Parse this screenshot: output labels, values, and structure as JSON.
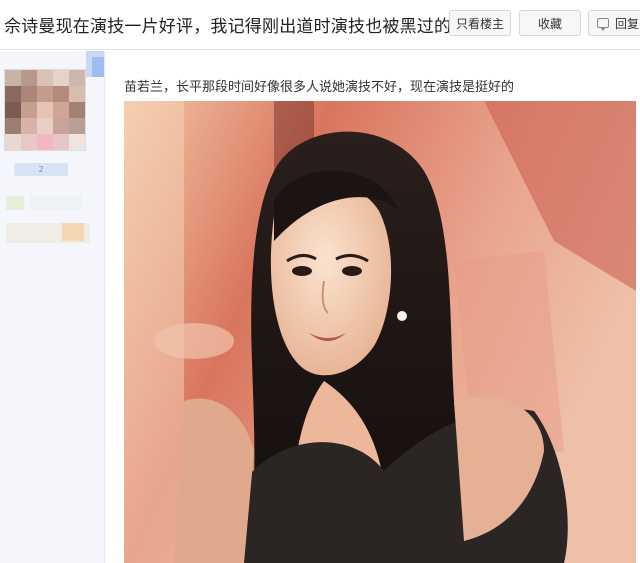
{
  "thread": {
    "title": "佘诗曼现在演技一片好评，我记得刚出道时演技也被黑过的"
  },
  "actions": {
    "owner_only_label": "只看楼主",
    "favorite_label": "收藏",
    "reply_label": "回复"
  },
  "sidebar": {
    "user_level": "2"
  },
  "post": {
    "text": "苗若兰，长平那段时间好像很多人说她演技不好，现在演技是挺好的"
  },
  "colors": {
    "sidebar_bg": "#f4f6fb",
    "button_bg": "#f7f7f7",
    "photo_warm": "#d98a6e"
  }
}
